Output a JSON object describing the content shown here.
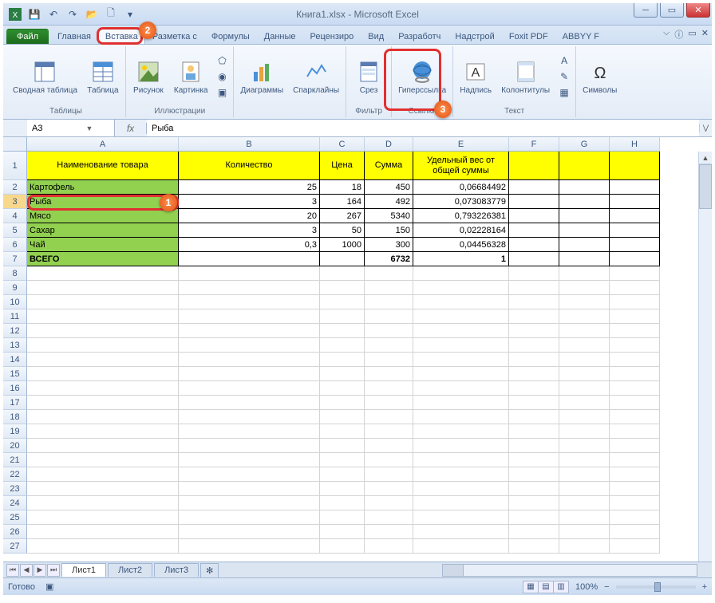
{
  "title": "Книга1.xlsx - Microsoft Excel",
  "qat": {
    "save": "💾",
    "undo": "↶",
    "redo": "↷",
    "open": "📂",
    "new": "🗋"
  },
  "tabs": {
    "file": "Файл",
    "items": [
      "Главная",
      "Вставка",
      "Разметка с",
      "Формулы",
      "Данные",
      "Рецензиро",
      "Вид",
      "Разработч",
      "Надстрой",
      "Foxit PDF",
      "ABBYY F"
    ],
    "active_index": 1,
    "right": [
      "⌵",
      "ⓘ",
      "▭",
      "✕"
    ]
  },
  "ribbon": {
    "tables": {
      "pivot": "Сводная таблица",
      "table": "Таблица",
      "label": "Таблицы"
    },
    "illus": {
      "picture": "Рисунок",
      "clip": "Картинка",
      "label": "Иллюстрации"
    },
    "charts": {
      "chart": "Диаграммы",
      "spark": "Спарклайны",
      "label": ""
    },
    "filter": {
      "slice": "Срез",
      "label": "Фильтр"
    },
    "links": {
      "hyper": "Гиперссылка",
      "label": "Ссылки"
    },
    "text": {
      "box": "Надпись",
      "hf": "Колонтитулы",
      "label": "Текст"
    },
    "symbols": {
      "sym": "Символы",
      "label": ""
    }
  },
  "fx": {
    "name": "A3",
    "value": "Рыба"
  },
  "cols": [
    "A",
    "B",
    "C",
    "D",
    "E",
    "F",
    "G",
    "H"
  ],
  "header_row": [
    "Наименование товара",
    "Количество",
    "Цена",
    "Сумма",
    "Удельный вес от общей суммы",
    "",
    "",
    ""
  ],
  "data": [
    {
      "n": 2,
      "a": "Картофель",
      "b": "25",
      "c": "18",
      "d": "450",
      "e": "0,06684492"
    },
    {
      "n": 3,
      "a": "Рыба",
      "b": "3",
      "c": "164",
      "d": "492",
      "e": "0,073083779"
    },
    {
      "n": 4,
      "a": "Мясо",
      "b": "20",
      "c": "267",
      "d": "5340",
      "e": "0,793226381"
    },
    {
      "n": 5,
      "a": "Сахар",
      "b": "3",
      "c": "50",
      "d": "150",
      "e": "0,02228164"
    },
    {
      "n": 6,
      "a": "Чай",
      "b": "0,3",
      "c": "1000",
      "d": "300",
      "e": "0,04456328"
    }
  ],
  "total": {
    "n": 7,
    "a": "ВСЕГО",
    "d": "6732",
    "e": "1"
  },
  "sheets": [
    "Лист1",
    "Лист2",
    "Лист3"
  ],
  "status": {
    "ready": "Готово",
    "zoom": "100%"
  },
  "badges": {
    "1": "1",
    "2": "2",
    "3": "3"
  }
}
